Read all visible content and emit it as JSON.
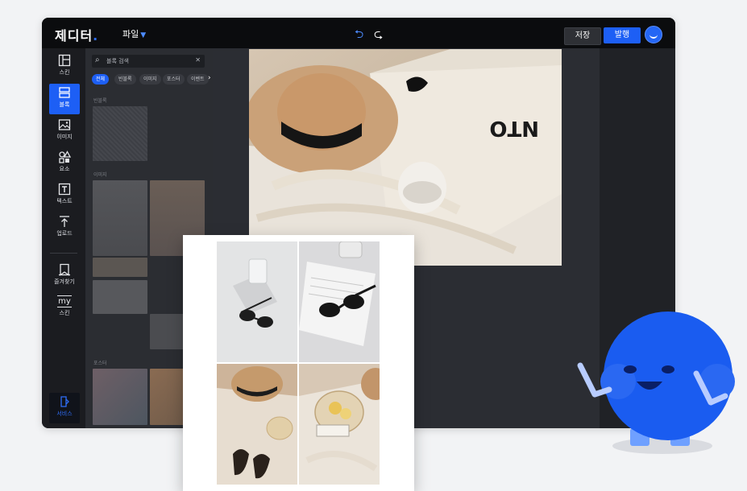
{
  "app": {
    "logo": "제디터",
    "file_menu": "파일",
    "save_label": "저장",
    "publish_label": "발행"
  },
  "rail": {
    "items": [
      {
        "label": "스킨",
        "icon": "layout-icon"
      },
      {
        "label": "블록",
        "icon": "block-icon"
      },
      {
        "label": "이미지",
        "icon": "image-icon"
      },
      {
        "label": "요소",
        "icon": "shapes-icon"
      },
      {
        "label": "텍스트",
        "icon": "text-icon"
      },
      {
        "label": "업로드",
        "icon": "upload-icon"
      },
      {
        "label": "즐겨찾기",
        "icon": "bookmark-icon"
      },
      {
        "label": "스킨",
        "icon": "my-skin-icon"
      },
      {
        "label": "서비스",
        "icon": "service-icon"
      }
    ],
    "active_index": 1,
    "my_badge": "my"
  },
  "panel": {
    "search_placeholder": "블록 검색",
    "chips": [
      "전체",
      "빈블록",
      "이미지",
      "포스터",
      "이벤트"
    ],
    "sections": [
      "빈블록",
      "이미지",
      "포스터"
    ]
  },
  "colors": {
    "accent": "#1d5ff5",
    "topbar": "#0b0c0e",
    "panel": "#2b2d32",
    "mascot": "#1a5cf0"
  }
}
